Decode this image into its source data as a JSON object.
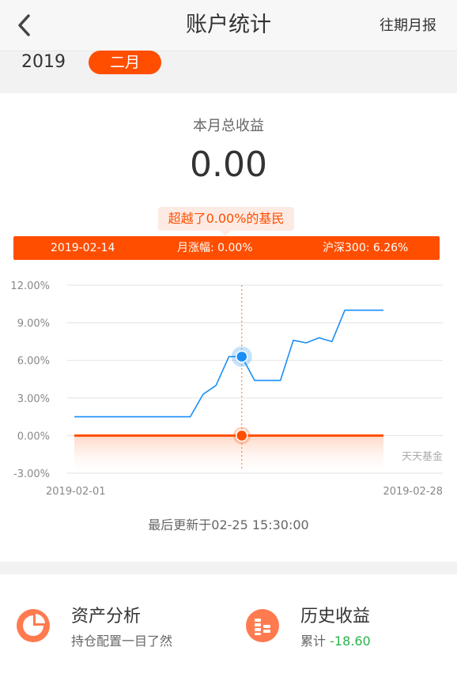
{
  "header": {
    "title": "账户统计",
    "history_link": "往期月报"
  },
  "period": {
    "year": "2019",
    "month": "二月"
  },
  "summary": {
    "total_label": "本月总收益",
    "total_value": "0.00",
    "beat_text": "超越了0.00%的基民"
  },
  "info_bar": {
    "date": "2019-02-14",
    "monthly_change": "月涨幅: 0.00%",
    "index_change": "沪深300: 6.26%"
  },
  "chart_data": {
    "type": "line",
    "y_tick_labels": [
      "12.00%",
      "9.00%",
      "6.00%",
      "3.00%",
      "0.00%",
      "-3.00%"
    ],
    "ylim": [
      -3,
      12
    ],
    "x_tick_labels": [
      "2019-02-01",
      "2019-02-28"
    ],
    "watermark": "天天基金",
    "highlight_date": "2019-02-14",
    "series": [
      {
        "color": "#1a8ef7",
        "x": [
          "2019-02-01",
          "2019-02-02",
          "2019-02-03",
          "2019-02-04",
          "2019-02-05",
          "2019-02-06",
          "2019-02-07",
          "2019-02-08",
          "2019-02-09",
          "2019-02-10",
          "2019-02-11",
          "2019-02-12",
          "2019-02-13",
          "2019-02-14",
          "2019-02-15",
          "2019-02-16",
          "2019-02-17",
          "2019-02-18",
          "2019-02-19",
          "2019-02-20",
          "2019-02-21",
          "2019-02-22",
          "2019-02-23",
          "2019-02-24",
          "2019-02-25"
        ],
        "values": [
          1.5,
          1.5,
          1.5,
          1.5,
          1.5,
          1.5,
          1.5,
          1.5,
          1.5,
          1.5,
          3.3,
          4.0,
          6.3,
          6.3,
          4.4,
          4.4,
          4.4,
          7.6,
          7.4,
          7.8,
          7.5,
          10.0,
          10.0,
          10.0,
          10.0
        ]
      },
      {
        "color": "#ff4e00",
        "x": [
          "2019-02-01",
          "2019-02-25"
        ],
        "values": [
          0,
          0
        ]
      }
    ]
  },
  "footer": {
    "update_time": "最后更新于02-25 15:30:00",
    "asset_title": "资产分析",
    "asset_sub": "持仓配置一目了然",
    "history_title": "历史收益",
    "history_sub_prefix": "累计",
    "history_value": "-18.60"
  },
  "colors": {
    "accent": "#ff4e00",
    "blue": "#1a8ef7",
    "green": "#2bb24c"
  },
  "icons": {
    "back": "chevron-left-icon",
    "pie": "pie-chart-icon",
    "coins": "coins-icon"
  }
}
